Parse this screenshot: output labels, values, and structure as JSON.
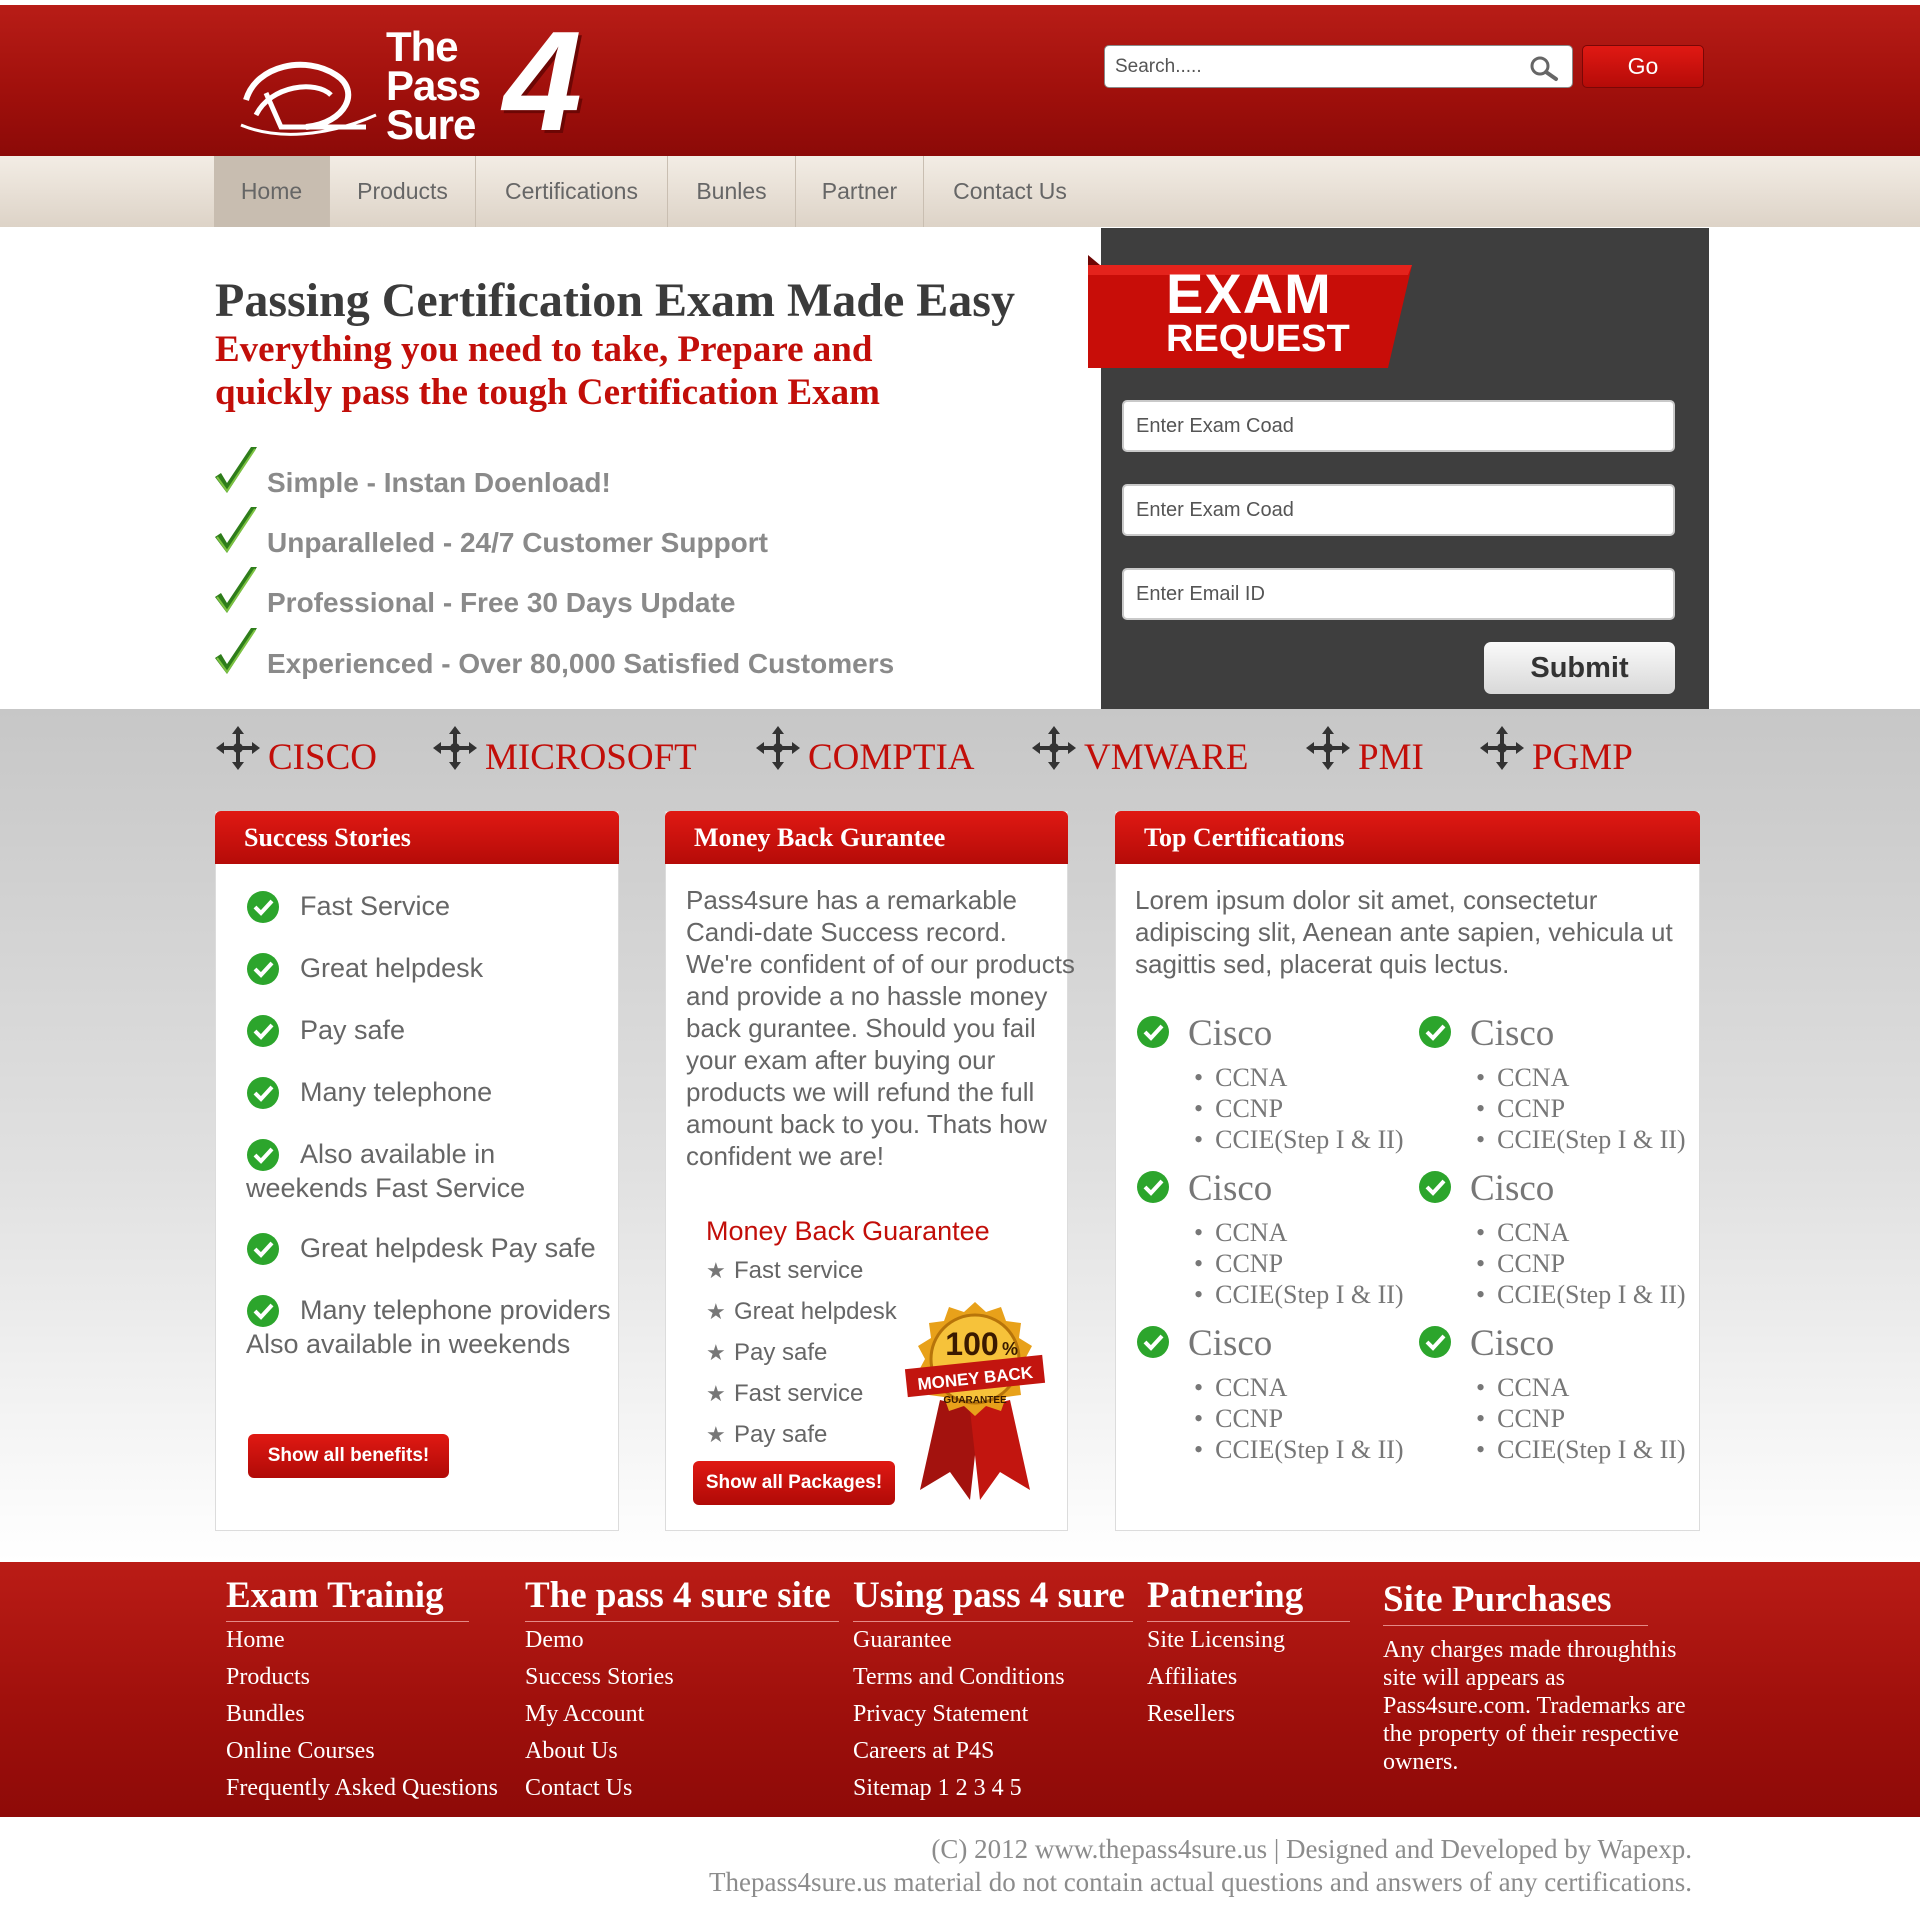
{
  "header": {
    "logo": {
      "word1": "The",
      "word2": "Pass",
      "word3": "Sure",
      "number": "4"
    },
    "search": {
      "placeholder": "Search.....",
      "go_label": "Go"
    }
  },
  "nav": {
    "items": [
      "Home",
      "Products",
      "Certifications",
      "Bunles",
      "Partner",
      "Contact Us"
    ],
    "active": "Home"
  },
  "hero": {
    "title": "Passing Certification Exam Made Easy",
    "subtitle": "Everything you need to take, Prepare and quickly pass the tough Certification Exam",
    "features": [
      {
        "label": "Simple - Instan Doenload!"
      },
      {
        "label": "Unparalleled - 24/7 Customer Support"
      },
      {
        "label": "Professional - Free 30 Days Update"
      },
      {
        "label": "Experienced - Over 80,000 Satisfied Customers"
      }
    ]
  },
  "exam_request": {
    "banner_line1": "EXAM",
    "banner_line2": "REQUEST",
    "fields": [
      "Enter Exam Coad",
      "Enter Exam Coad",
      "Enter Email ID"
    ],
    "submit_label": "Submit"
  },
  "vendors": [
    "CISCO",
    "MICROSOFT",
    "COMPTIA",
    "VMWARE",
    "PMI",
    "PGMP"
  ],
  "success_stories": {
    "title": "Success Stories",
    "items": [
      "Fast Service",
      "Great helpdesk",
      "Pay safe",
      "Many telephone",
      "Also available in weekends Fast Service",
      "Great helpdesk Pay safe",
      "Many telephone providers Also available in weekends"
    ],
    "button_label": "Show all benefits!"
  },
  "money_back": {
    "title": "Money Back Gurantee",
    "text": "Pass4sure has a remarkable Candi-date Success record. We're confident of of our products and provide a no hassle money back gurantee. Should you fail your exam after buying our products we will refund the full amount back to you. Thats how confident we are!",
    "subtitle": "Money Back Guarantee",
    "items": [
      "Fast service",
      "Great helpdesk",
      "Pay safe",
      "Fast service",
      "Pay safe"
    ],
    "button_label": "Show all Packages!",
    "badge": {
      "percent": "100",
      "percent_sign": "%",
      "line1": "MONEY BACK",
      "line2": "GUARANTEE"
    }
  },
  "top_certifications": {
    "title": "Top Certifications",
    "text": "Lorem ipsum dolor sit amet, consectetur adipiscing slit, Aenean ante sapien, vehicula ut sagittis sed, placerat quis lectus.",
    "groups": [
      {
        "name": "Cisco",
        "items": [
          "CCNA",
          "CCNP",
          "CCIE(Step I & II)"
        ]
      },
      {
        "name": "Cisco",
        "items": [
          "CCNA",
          "CCNP",
          "CCIE(Step I & II)"
        ]
      },
      {
        "name": "Cisco",
        "items": [
          "CCNA",
          "CCNP",
          "CCIE(Step I & II)"
        ]
      },
      {
        "name": "Cisco",
        "items": [
          "CCNA",
          "CCNP",
          "CCIE(Step I & II)"
        ]
      },
      {
        "name": "Cisco",
        "items": [
          "CCNA",
          "CCNP",
          "CCIE(Step I & II)"
        ]
      },
      {
        "name": "Cisco",
        "items": [
          "CCNA",
          "CCNP",
          "CCIE(Step I & II)"
        ]
      }
    ]
  },
  "footer": {
    "columns": [
      {
        "title": "Exam Trainig",
        "links": [
          "Home",
          "Products",
          "Bundles",
          "Online Courses",
          "Frequently Asked Questions"
        ]
      },
      {
        "title": "The pass 4 sure site",
        "links": [
          "Demo",
          "Success Stories",
          "My Account",
          "About Us",
          "Contact Us"
        ]
      },
      {
        "title": "Using pass 4 sure",
        "links": [
          "Guarantee",
          "Terms and Conditions",
          "Privacy Statement",
          "Careers at P4S",
          "Sitemap 1 2 3 4 5"
        ]
      },
      {
        "title": "Patnering",
        "links": [
          "Site Licensing",
          "Affiliates",
          "Resellers"
        ]
      }
    ],
    "purchases": {
      "title": "Site Purchases",
      "text": "Any charges made throughthis site will appears as Pass4sure.com. Trademarks are the property of their respective owners."
    }
  },
  "copyright": {
    "line1": "(C) 2012 www.thepass4sure.us | Designed and Developed by Wapexp.",
    "line2": "Thepass4sure.us material do not contain actual questions and answers of any certifications."
  },
  "colors": {
    "brand_red": "#b50b08",
    "accent_red": "#c20e09",
    "panel_dark": "#3e3e3e",
    "nav_beige": "#e8e0d6",
    "check_green": "#2ca52c"
  }
}
